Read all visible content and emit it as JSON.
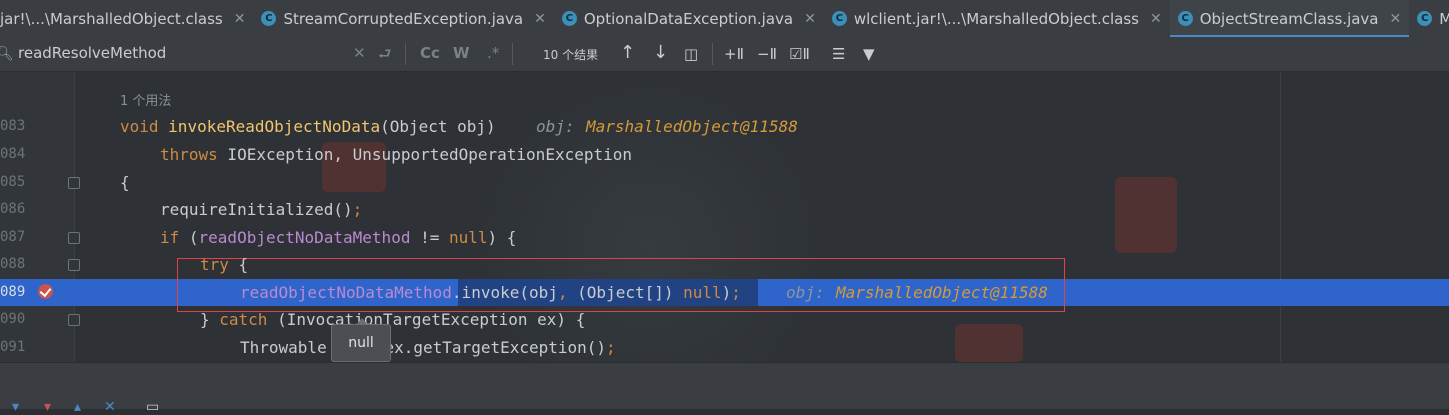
{
  "tabs": [
    {
      "label": "jar!\\...\\MarshalledObject.class",
      "active": false,
      "icon": "class-icon"
    },
    {
      "label": "StreamCorruptedException.java",
      "active": false,
      "icon": "class-icon"
    },
    {
      "label": "OptionalDataException.java",
      "active": false,
      "icon": "class-icon"
    },
    {
      "label": "wlclient.jar!\\...\\MarshalledObject.class",
      "active": false,
      "icon": "class-icon"
    },
    {
      "label": "ObjectStreamClass.java",
      "active": true,
      "icon": "class-icon"
    },
    {
      "label": "Metho",
      "active": false,
      "icon": "class-icon"
    }
  ],
  "search": {
    "query": "readResolveMethod",
    "result_count": "10 个结果",
    "match_case": "Cc",
    "whole_word": "W",
    "regex": ".*"
  },
  "editor": {
    "usage_hint": "1 个用法",
    "lines": [
      {
        "num": "083",
        "text": "void invokeReadObjectNoData(Object obj)",
        "hint_label": "obj:",
        "hint_value": "MarshalledObject@11588"
      },
      {
        "num": "084",
        "text": "throws IOException, UnsupportedOperationException"
      },
      {
        "num": "085",
        "text": "{"
      },
      {
        "num": "086",
        "text": "requireInitialized();"
      },
      {
        "num": "087",
        "text": "if (readObjectNoDataMethod != null) {"
      },
      {
        "num": "088",
        "text": "try {"
      },
      {
        "num": "089",
        "text": "readObjectNoDataMethod.invoke(obj, (Object[]) null);",
        "hint_label": "obj:",
        "hint_value": "MarshalledObject@11588"
      },
      {
        "num": "090",
        "text": "} catch (InvocationTargetException ex) {"
      },
      {
        "num": "091",
        "text": "Throwable th = ex.getTargetException();"
      }
    ],
    "tooltip": "null",
    "current_line": "089"
  },
  "colors": {
    "execution_line": "#2f65ca",
    "highlight_box": "#e0424a",
    "keyword": "#cc8a44",
    "method": "#f2c56d",
    "field": "#b98ad0",
    "inline_value": "#d39a3a"
  }
}
